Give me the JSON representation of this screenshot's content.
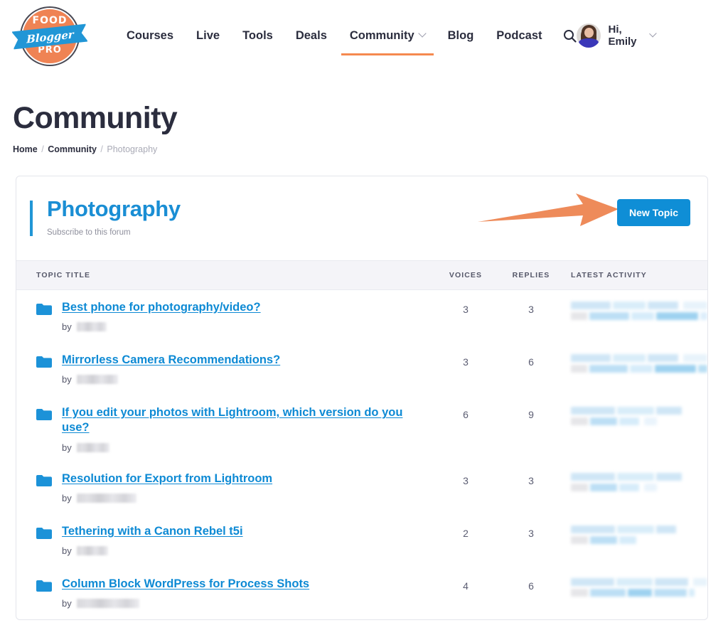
{
  "header": {
    "logo": {
      "top": "FOOD",
      "script": "Blogger",
      "bottom": "PRO"
    },
    "nav": [
      {
        "label": "Courses",
        "active": false,
        "caret": false
      },
      {
        "label": "Live",
        "active": false,
        "caret": false
      },
      {
        "label": "Tools",
        "active": false,
        "caret": false
      },
      {
        "label": "Deals",
        "active": false,
        "caret": false
      },
      {
        "label": "Community",
        "active": true,
        "caret": true
      },
      {
        "label": "Blog",
        "active": false,
        "caret": false
      },
      {
        "label": "Podcast",
        "active": false,
        "caret": false
      }
    ],
    "search_icon": "search-icon",
    "user_greeting": "Hi, Emily"
  },
  "page": {
    "title": "Community",
    "breadcrumb": {
      "home": "Home",
      "community": "Community",
      "current": "Photography",
      "separator": "/"
    }
  },
  "forum": {
    "title": "Photography",
    "subscribe_label": "Subscribe to this forum",
    "new_topic_label": "New Topic",
    "accent_color": "#2196d6",
    "button_color": "#0f8ed6",
    "annotation_arrow_color": "#ee8b5a"
  },
  "table": {
    "columns": {
      "title": "TOPIC TITLE",
      "voices": "VOICES",
      "replies": "REPLIES",
      "latest": "LATEST ACTIVITY"
    },
    "rows": [
      {
        "title": "Best phone for photography/video?",
        "by_label": "by",
        "author_redacted_width": 42,
        "voices": "3",
        "replies": "3",
        "latest_redacted": true
      },
      {
        "title": "Mirrorless Camera Recommendations?",
        "by_label": "by",
        "author_redacted_width": 58,
        "voices": "3",
        "replies": "6",
        "latest_redacted": true
      },
      {
        "title": "If you edit your photos with Lightroom, which version do you use?",
        "by_label": "by",
        "author_redacted_width": 46,
        "voices": "6",
        "replies": "9",
        "latest_redacted": true
      },
      {
        "title": "Resolution for Export from Lightroom",
        "by_label": "by",
        "author_redacted_width": 84,
        "voices": "3",
        "replies": "3",
        "latest_redacted": true
      },
      {
        "title": "Tethering with a Canon Rebel t5i",
        "by_label": "by",
        "author_redacted_width": 44,
        "voices": "2",
        "replies": "3",
        "latest_redacted": true
      },
      {
        "title": "Column Block WordPress for Process Shots",
        "by_label": "by",
        "author_redacted_width": 88,
        "voices": "4",
        "replies": "6",
        "latest_redacted": true
      }
    ]
  }
}
